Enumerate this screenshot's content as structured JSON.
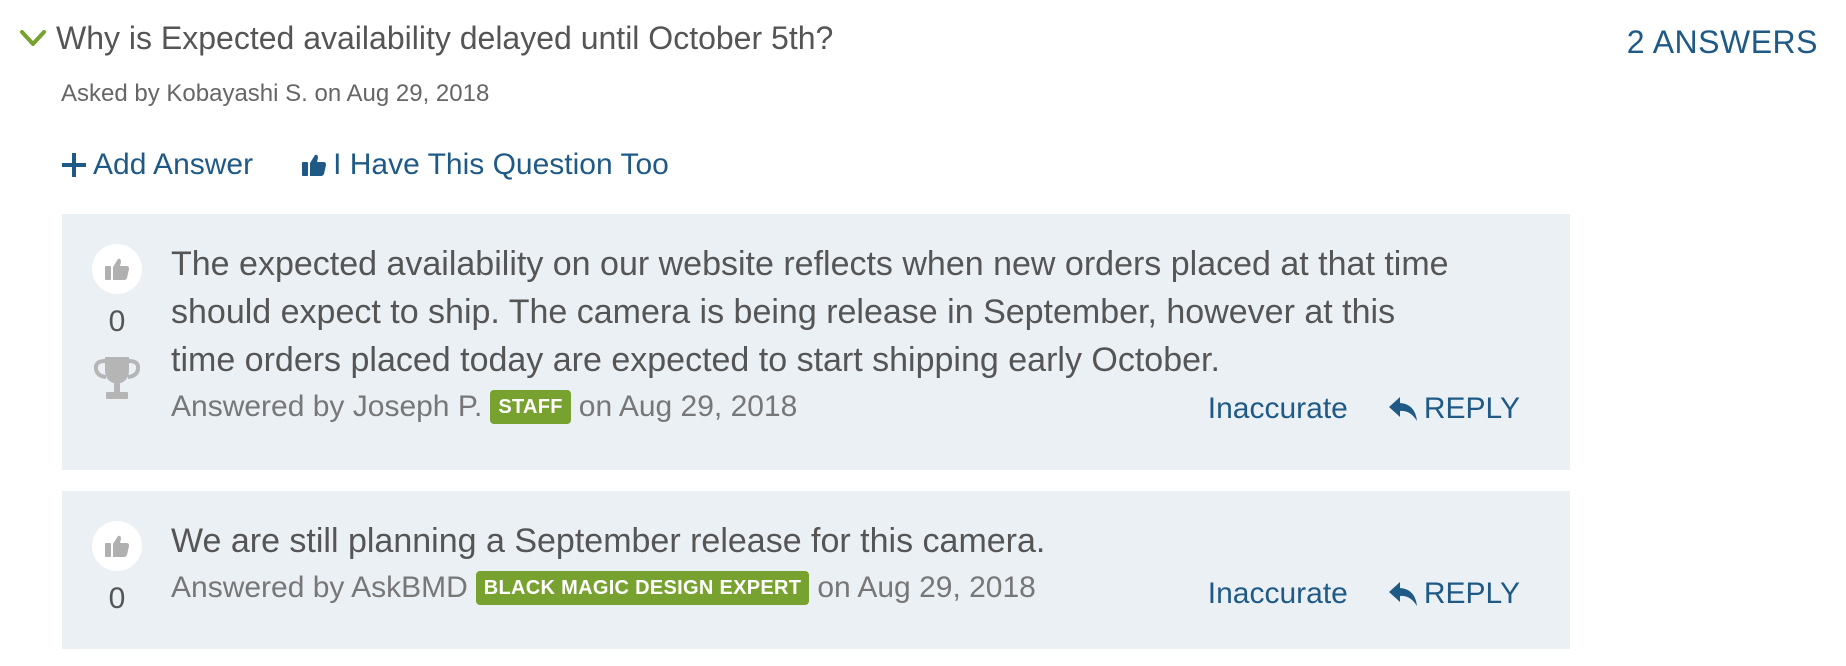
{
  "question": {
    "title": "Why is Expected availability delayed until October 5th?",
    "asked_by": "Asked by Kobayashi S. on Aug 29, 2018",
    "answers_count": "2 ANSWERS"
  },
  "actions": {
    "add_answer": "Add Answer",
    "have_question_too": "I Have This Question Too"
  },
  "answers": [
    {
      "text": "The expected availability on our website reflects when new orders placed at that time should expect to ship. The camera is being release in September, however at this time orders placed today are expected to start shipping early October.",
      "votes": "0",
      "answered_prefix": "Answered by Joseph P.",
      "badge": "STAFF",
      "date": "on Aug 29, 2018",
      "inaccurate": "Inaccurate",
      "reply": "REPLY"
    },
    {
      "text": "We are still planning a September release for this camera.",
      "votes": "0",
      "answered_prefix": "Answered by AskBMD",
      "badge": "BLACK MAGIC DESIGN EXPERT",
      "date": "on Aug 29, 2018",
      "inaccurate": "Inaccurate",
      "reply": "REPLY"
    }
  ],
  "icons": {
    "collapse": "chevron-down-icon",
    "add": "plus-icon",
    "thumb": "thumbs-up-icon",
    "trophy": "trophy-icon",
    "reply": "reply-arrow-icon"
  },
  "colors": {
    "link": "#1f5a87",
    "chevron": "#78a22f",
    "badge": "#78a22f",
    "answer_bg": "#ebf0f4"
  }
}
